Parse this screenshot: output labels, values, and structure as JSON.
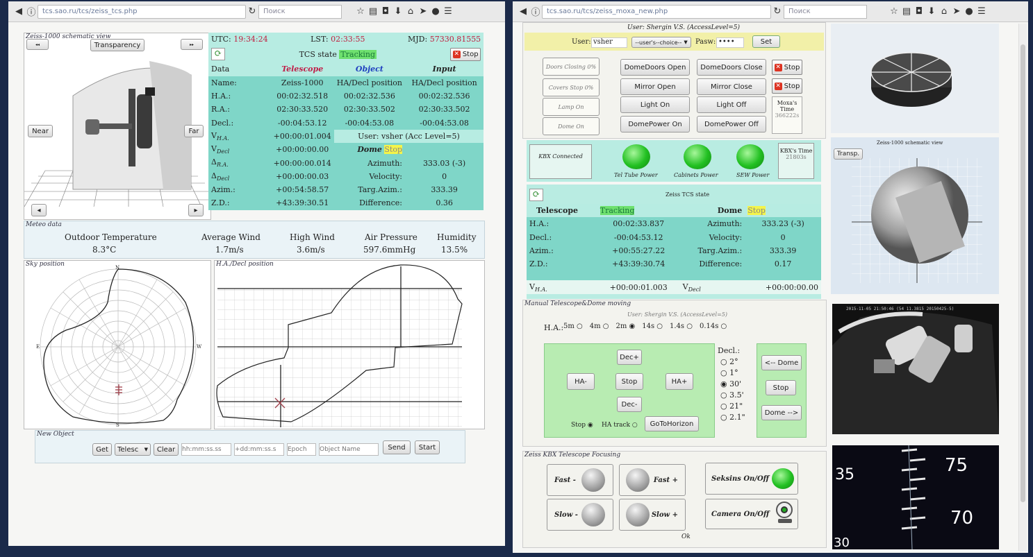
{
  "left_window": {
    "url": "tcs.sao.ru/tcs/zeiss_tcs.php",
    "search_placeholder": "Поиск",
    "schematic": {
      "title": "Zeiss-1000 schematic view",
      "transparency_label": "Transparency",
      "near_label": "Near",
      "far_label": "Far"
    },
    "header": {
      "utc_label": "UTC:",
      "utc_value": "19:34:24",
      "lst_label": "LST:",
      "lst_value": "02:33:55",
      "mjd_label": "MJD:",
      "mjd_value": "57330.81555",
      "tcs_state_label": "TCS state",
      "tcs_state_value": "Tracking",
      "stop_label": "Stop"
    },
    "columns": {
      "data": "Data",
      "telescope": "Telescope",
      "object": "Object",
      "input": "Input"
    },
    "rows": [
      {
        "label": "Name:",
        "telescope": "Zeiss-1000",
        "object": "HA/Decl position",
        "input": "HA/Decl position"
      },
      {
        "label": "H.A.:",
        "telescope": "00:02:32.518",
        "object": "00:02:32.536",
        "input": "00:02:32.536"
      },
      {
        "label": "R.A.:",
        "telescope": "02:30:33.520",
        "object": "02:30:33.502",
        "input": "02:30:33.502"
      },
      {
        "label": "Decl.:",
        "telescope": "-00:04:53.12",
        "object": "-00:04:53.08",
        "input": "-00:04:53.08"
      }
    ],
    "v_ha": {
      "label": "V",
      "sub": "H.A.",
      "value": "+00:00:01.004",
      "user": "User: vsher (Acc Level=5)"
    },
    "v_decl": {
      "label": "V",
      "sub": "Decl",
      "value": "+00:00:00.00",
      "dome_label": "Dome",
      "dome_state": "Stop"
    },
    "d_ra": {
      "label": "Δ",
      "sub": "R.A.",
      "value": "+00:00:00.014",
      "key": "Azimuth:",
      "val": "333.03 (-3)"
    },
    "d_decl": {
      "label": "Δ",
      "sub": "Decl",
      "value": "+00:00:00.03",
      "key": "Velocity:",
      "val": "0"
    },
    "azim": {
      "label": "Azim.:",
      "value": "+00:54:58.57",
      "key": "Targ.Azim.:",
      "val": "333.39"
    },
    "zd": {
      "label": "Z.D.:",
      "value": "+43:39:30.51",
      "key": "Difference:",
      "val": "0.36"
    },
    "meteo": {
      "title": "Meteo data",
      "items": [
        {
          "label": "Outdoor Temperature",
          "value": "8.3°C"
        },
        {
          "label": "Average Wind",
          "value": "1.7m/s"
        },
        {
          "label": "High Wind",
          "value": "3.6m/s"
        },
        {
          "label": "Air Pressure",
          "value": "597.6mmHg"
        },
        {
          "label": "Humidity",
          "value": "13.5%"
        }
      ]
    },
    "sky_title": "Sky position",
    "sky_dirs": {
      "n": "N",
      "s": "S",
      "e": "E",
      "w": "W"
    },
    "hadecl_title": "H.A./Decl position",
    "new_object": {
      "title": "New Object",
      "get_label": "Get",
      "select_value": "Telesc",
      "clear_label": "Clear",
      "ra_placeholder": "hh:mm:ss.ss",
      "dec_placeholder": "+dd:mm:ss.s",
      "epoch_placeholder": "Epoch",
      "name_placeholder": "Object Name",
      "send_label": "Send",
      "start_label": "Start"
    }
  },
  "right_window": {
    "url": "tcs.sao.ru/tcs/zeiss_moxa_new.php",
    "search_placeholder": "Поиск",
    "user_title": "User: Shergin V.S. (AccessLevel=5)",
    "user_label": "User:",
    "user_value": "vsher",
    "choice_value": "--user's--choice--",
    "pasw_label": "Pasw:",
    "pasw_value": "••••",
    "set_label": "Set",
    "moxa": {
      "status": [
        "Doors Closing 0%",
        "Covers Stop 0%",
        "Lamp On",
        "Dome On"
      ],
      "left_buttons": [
        "DomeDoors Open",
        "Mirror Open",
        "Light On",
        "DomePower On"
      ],
      "right_buttons": [
        "DomeDoors Close",
        "Mirror Close",
        "Light Off",
        "DomePower Off"
      ],
      "stop_label": "Stop",
      "time_label": "Moxa's Time",
      "time_value": "366222s"
    },
    "kbx": {
      "connected": "KBX Connected",
      "leds": [
        "Tel Tube Power",
        "Cabinets Power",
        "SEW Power"
      ],
      "time_label": "KBX's Time",
      "time_value": "21803s"
    },
    "tcs2": {
      "title": "Zeiss TCS state",
      "telescope_label": "Telescope",
      "telescope_state": "Tracking",
      "dome_label": "Dome",
      "dome_state": "Stop",
      "rows": [
        {
          "label": "H.A.:",
          "value": "00:02:33.837",
          "key": "Azimuth:",
          "val": "333.23 (-3)"
        },
        {
          "label": "Decl.:",
          "value": "-00:04:53.12",
          "key": "Velocity:",
          "val": "0"
        },
        {
          "label": "Azim.:",
          "value": "+00:55:27.22",
          "key": "Targ.Azim.:",
          "val": "333.39"
        },
        {
          "label": "Z.D.:",
          "value": "+43:39:30.74",
          "key": "Difference:",
          "val": "0.17"
        }
      ],
      "vha_label": "V",
      "vha_sub": "H.A.",
      "vha_value": "+00:00:01.003",
      "vdecl_label": "V",
      "vdecl_sub": "Decl",
      "vdecl_value": "+00:00:00.00"
    },
    "manual": {
      "title": "Manual Telescope&Dome moving",
      "user": "User: Shergin V.S. (AccessLevel=5)",
      "ha_label": "H.A.:",
      "ha_steps": [
        "5m",
        "4m",
        "2m",
        "14s",
        "1.4s",
        "0.14s"
      ],
      "ha_selected": 2,
      "decl_label": "Decl.:",
      "decl_steps": [
        "2°",
        "1°",
        "30'",
        "3.5'",
        "21\"",
        "2.1\""
      ],
      "decl_selected": 2,
      "dec_plus": "Dec+",
      "dec_minus": "Dec-",
      "ha_minus": "HA-",
      "ha_plus": "HA+",
      "stop": "Stop",
      "stop_radio": "Stop",
      "ha_track": "HA track",
      "goto_horizon": "GoToHorizon",
      "dome_left": "<-- Dome",
      "dome_stop": "Stop",
      "dome_right": "Dome -->"
    },
    "focus": {
      "title": "Zeiss KBX Telescope Focusing",
      "fast_minus": "Fast -",
      "fast_plus": "Fast +",
      "slow_minus": "Slow -",
      "slow_plus": "Slow +",
      "seksins": "Seksins On/Off",
      "camera": "Camera On/Off",
      "ok": "Ok"
    },
    "schematic2": {
      "title": "Zeiss-1000 schematic view",
      "transp": "Transp."
    },
    "cam_overlay": "2015-11-05 21:50:46 (54 11.3815 20150425-5)",
    "scale_numbers": [
      "35",
      "75",
      "70",
      "30"
    ]
  }
}
